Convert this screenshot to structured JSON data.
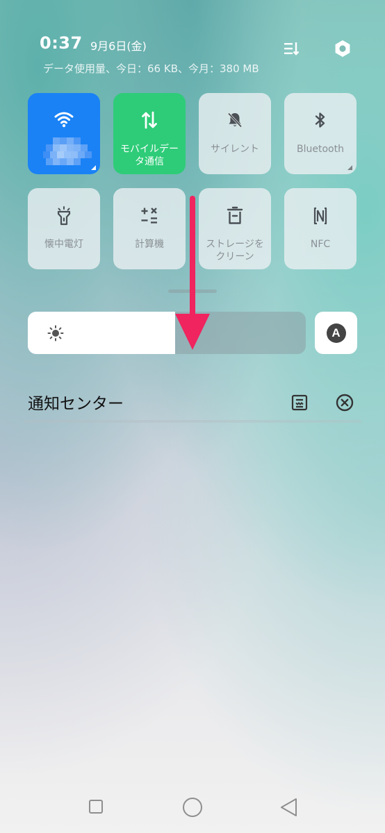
{
  "header": {
    "time": "0:37",
    "date": "9月6日(金)",
    "data_usage": "データ使用量、今日：66 KB、今月：380 MB",
    "icons": [
      "edit-tiles-icon",
      "settings-icon"
    ]
  },
  "tiles": [
    {
      "id": "wifi",
      "label": "",
      "icon": "wifi-icon",
      "state": "on",
      "color": "#1a82f5"
    },
    {
      "id": "mobile-data",
      "label": "モバイルデータ通信",
      "label_lines": [
        "モバイルデー",
        "タ通信"
      ],
      "icon": "mobile-data-icon",
      "state": "on",
      "color": "#2ecc78"
    },
    {
      "id": "silent",
      "label": "サイレント",
      "icon": "bell-off-icon",
      "state": "off"
    },
    {
      "id": "bluetooth",
      "label": "Bluetooth",
      "icon": "bluetooth-icon",
      "state": "off"
    },
    {
      "id": "flashlight",
      "label": "懐中電灯",
      "icon": "flashlight-icon",
      "state": "off"
    },
    {
      "id": "calculator",
      "label": "計算機",
      "icon": "calculator-icon",
      "state": "off"
    },
    {
      "id": "storage-clean",
      "label": "ストレージをクリーン",
      "label_lines": [
        "ストレージを",
        "クリーン"
      ],
      "icon": "trash-icon",
      "state": "off"
    },
    {
      "id": "nfc",
      "label": "NFC",
      "icon": "nfc-icon",
      "state": "off"
    }
  ],
  "brightness": {
    "level": 0.53,
    "auto_label": "A"
  },
  "notification_center": {
    "title": "通知センター",
    "icons": [
      "notification-settings-icon",
      "clear-all-icon"
    ]
  },
  "annotation": {
    "color": "#f0245e"
  },
  "navbar": {
    "icons": [
      "recent-apps-icon",
      "home-icon",
      "back-icon"
    ]
  }
}
